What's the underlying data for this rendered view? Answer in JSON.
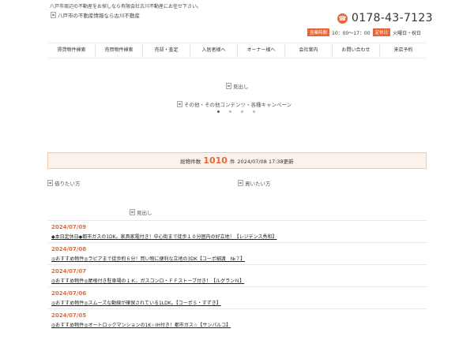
{
  "header": {
    "tagline": "八戸市周辺の不動産をお探しなら有限会社古川不動産にお任せ下さい。",
    "logo_alt": "八戸市の不動産情報なら古川不動産",
    "phone": "0178-43-7123",
    "hours_label": "営業時間",
    "hours": "10：00～17：00",
    "closed_label": "定休日",
    "closed": "火曜日・祝日"
  },
  "nav": {
    "items": [
      {
        "label": "賃貸物件検索"
      },
      {
        "label": "売買物件検索"
      },
      {
        "label": "売却・査定"
      },
      {
        "label": "入居者様へ"
      },
      {
        "label": "オーナー様へ"
      },
      {
        "label": "会社案内"
      },
      {
        "label": "お問い合わせ"
      },
      {
        "label": "来店予約"
      }
    ]
  },
  "slider": {
    "title_alt": "見出し",
    "campaign_alt": "その他・その他コンテンツ・各種キャンペーン",
    "active_dot": 1,
    "dot_count": 4
  },
  "stats": {
    "label": "総物件数",
    "count": "1010",
    "unit": "件",
    "updated": "2024/07/08 17:38更新"
  },
  "links": {
    "rent_alt": "借りたい方",
    "buy_alt": "買いたい方",
    "news_alt": "見出し"
  },
  "news": [
    {
      "date": "2024/07/09",
      "title": "◆本日定休日◆都市ガスの1DK。家具家電付き！中心街まで徒歩１０分圏内の好立地！【レジデンス秀和】"
    },
    {
      "date": "2024/07/08",
      "title": "◎おすすめ物件◎ラピアまで徒歩約６分！買い物に便利な立地の3DK【コーポ細渡　№７】"
    },
    {
      "date": "2024/07/07",
      "title": "◎おすすめ物件◎屋根付き駐車場の１Ｋ。ガスコンロ・ＦＦストーブ付き！【ルグランＮ】"
    },
    {
      "date": "2024/07/06",
      "title": "◎おすすめ物件◎スムーズな動線が確保されている1LDK。【コーポＳ・すずき】"
    },
    {
      "date": "2024/07/05",
      "title": "◎おすすめ物件◎オートロックマンションの1K☆IH付き！都市ガス☆【サンパルコ】"
    }
  ],
  "colors": {
    "accent": "#e8673a"
  }
}
